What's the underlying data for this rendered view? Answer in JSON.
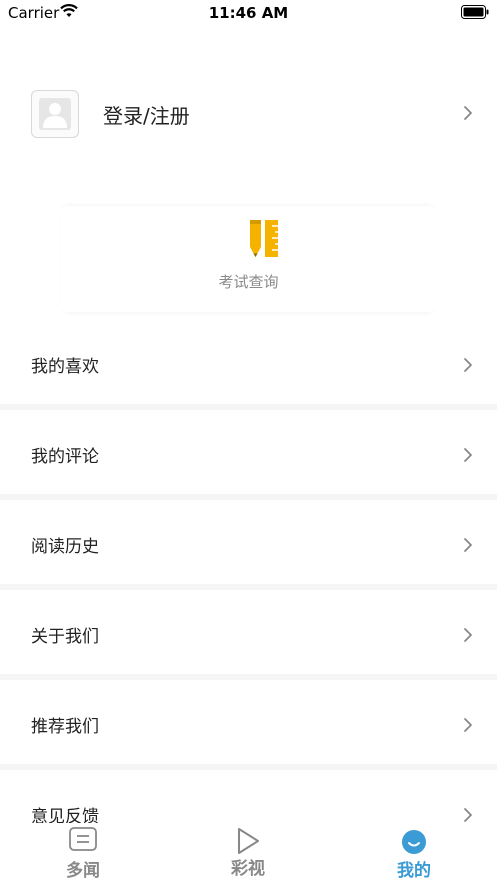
{
  "status_bar": {
    "carrier": "Carrier",
    "time": "11:46 AM"
  },
  "profile": {
    "login_label": "登录/注册"
  },
  "exam": {
    "label": "考试查询"
  },
  "menu": [
    {
      "label": "我的喜欢"
    },
    {
      "label": "我的评论"
    },
    {
      "label": "阅读历史"
    },
    {
      "label": "关于我们"
    },
    {
      "label": "推荐我们"
    },
    {
      "label": "意见反馈"
    }
  ],
  "tabs": [
    {
      "label": "多闻",
      "icon": "news-icon",
      "active": false
    },
    {
      "label": "彩视",
      "icon": "play-icon",
      "active": false
    },
    {
      "label": "我的",
      "icon": "smile-icon",
      "active": true
    }
  ],
  "colors": {
    "accent": "#3a9bd5",
    "exam_icon": "#f5b300",
    "tab_inactive": "#888888"
  }
}
